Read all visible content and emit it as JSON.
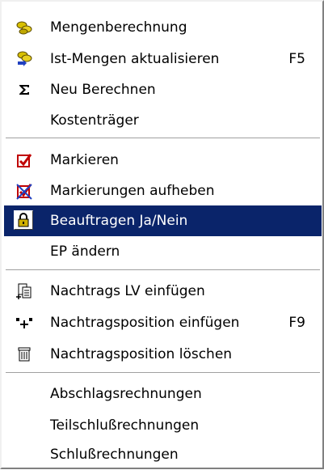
{
  "colors": {
    "highlight": "#0a246a",
    "highlight_text": "#ffffff"
  },
  "menu": {
    "items": [
      {
        "label": "Mengenberechnung",
        "icon": "coins-icon"
      },
      {
        "label": "Ist-Mengen aktualisieren",
        "shortcut": "F5",
        "icon": "coins-refresh-icon"
      },
      {
        "label": "Neu Berechnen",
        "icon": "sigma-icon"
      },
      {
        "label": "Kostenträger"
      },
      {
        "label": "Markieren",
        "icon": "checkbox-icon"
      },
      {
        "label": "Markierungen aufheben",
        "icon": "uncheck-icon"
      },
      {
        "label": "Beauftragen Ja/Nein",
        "icon": "lock-icon",
        "selected": true
      },
      {
        "label": "EP ändern"
      },
      {
        "label": "Nachtrags LV einfügen",
        "icon": "insert-document-icon"
      },
      {
        "label": "Nachtragsposition einfügen",
        "shortcut": "F9",
        "icon": "insert-position-icon"
      },
      {
        "label": "Nachtragsposition löschen",
        "icon": "trash-icon"
      },
      {
        "label": "Abschlagsrechnungen"
      },
      {
        "label": "Teilschlußrechnungen"
      },
      {
        "label": "Schlußrechnungen"
      }
    ]
  }
}
